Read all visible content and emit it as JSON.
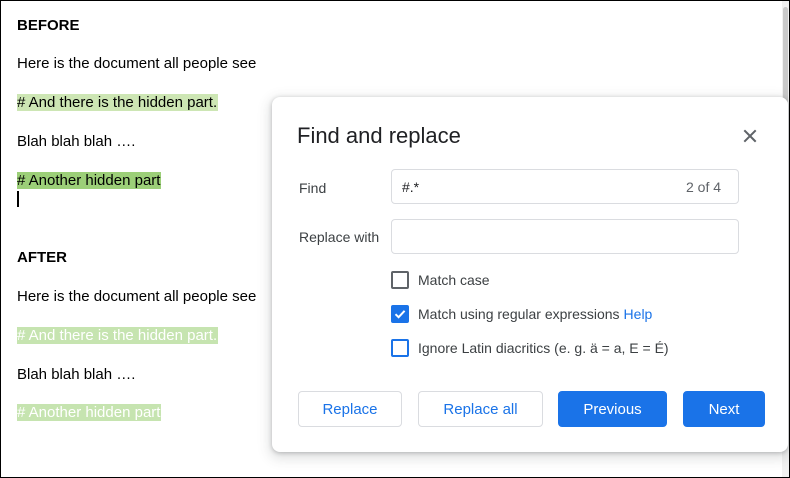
{
  "document": {
    "before_heading": "BEFORE",
    "before_lines": [
      "Here is the document all people see",
      "# And there is the hidden part.",
      "Blah blah blah ….",
      "# Another hidden part"
    ],
    "after_heading": "AFTER",
    "after_lines": [
      "Here is the document all people see",
      "# And there is the hidden part.",
      "Blah blah blah ….",
      "# Another hidden part"
    ]
  },
  "dialog": {
    "title": "Find and replace",
    "find_label": "Find",
    "find_value": "#.*",
    "find_count": "2 of 4",
    "replace_label": "Replace with",
    "replace_value": "",
    "options": [
      {
        "label": "Match case",
        "checked": false
      },
      {
        "label": "Match using regular expressions",
        "checked": true,
        "link": "Help"
      },
      {
        "label": "Ignore Latin diacritics (e. g. ä = a, E = É)",
        "checked": false
      }
    ],
    "buttons": {
      "replace": "Replace",
      "replace_all": "Replace all",
      "previous": "Previous",
      "next": "Next"
    }
  },
  "colors": {
    "accent": "#1a73e8",
    "match_highlight": "#cde6b4",
    "current_match_highlight": "#9ccf78"
  }
}
